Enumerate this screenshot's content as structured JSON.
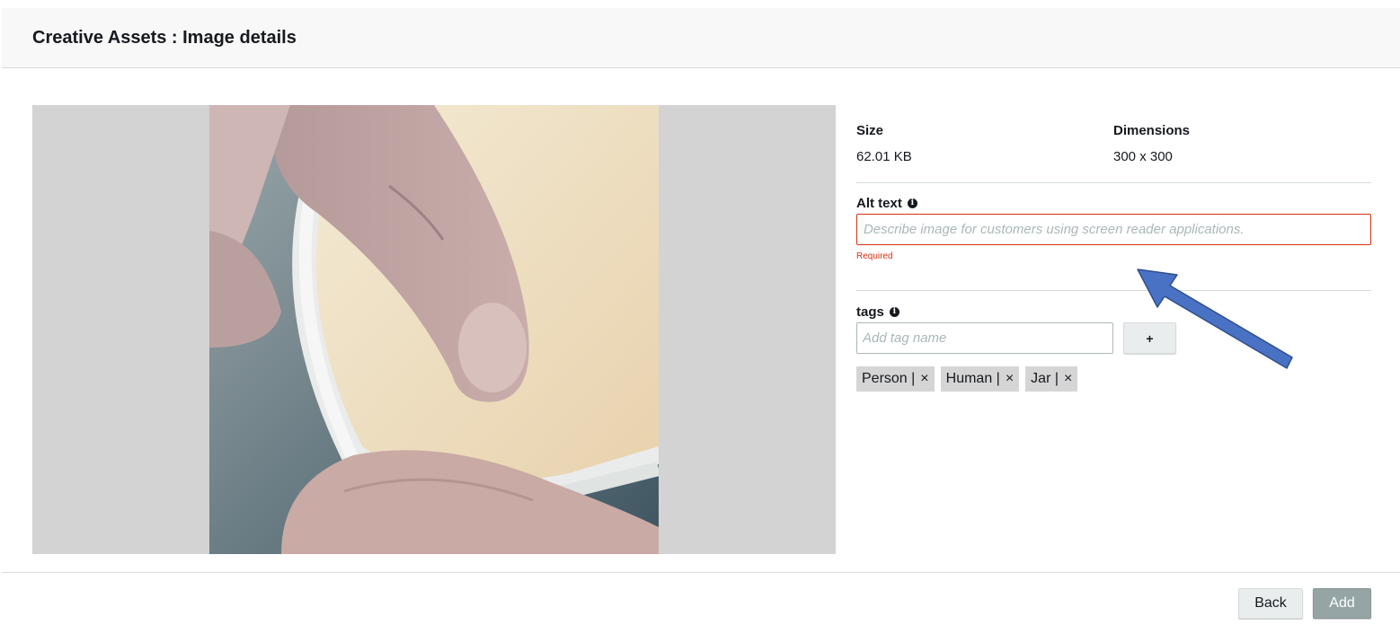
{
  "header": {
    "title": "Creative Assets : Image details"
  },
  "preview": {
    "image_subject": "finger-scooping-cream-from-jar"
  },
  "details": {
    "size_label": "Size",
    "size_value": "62.01 KB",
    "dimensions_label": "Dimensions",
    "dimensions_value": "300 x 300",
    "alt_text_label": "Alt text",
    "alt_text_placeholder": "Describe image for customers using screen reader applications.",
    "alt_text_value": "",
    "alt_text_error": "Required",
    "tags_label": "tags",
    "tag_input_placeholder": "Add tag name",
    "add_tag_label": "+",
    "tags": [
      {
        "label": "Person |",
        "close": "×"
      },
      {
        "label": "Human |",
        "close": "×"
      },
      {
        "label": "Jar |",
        "close": "×"
      }
    ]
  },
  "footer": {
    "back_label": "Back",
    "add_label": "Add"
  },
  "icons": {
    "info": "info-circle-icon",
    "close": "close-icon",
    "annotation": "blue-arrow-annotation"
  },
  "colors": {
    "error": "#d13212",
    "primary_disabled": "#95a5a6",
    "tag_chip": "#d5d5d5",
    "arrow": "#4a72c4"
  }
}
